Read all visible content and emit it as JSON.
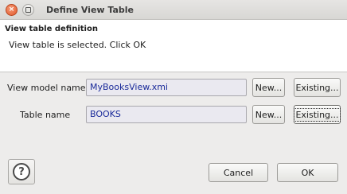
{
  "window": {
    "title": "Define View Table",
    "close_glyph": "×"
  },
  "header": {
    "title": "View table definition",
    "message": "View table is selected. Click OK"
  },
  "form": {
    "view_model_label": "View model name",
    "view_model_value": "MyBooksView.xmi",
    "table_name_label": "Table name",
    "table_name_value": "BOOKS",
    "new_label": "New...",
    "existing_label": "Existing..."
  },
  "footer": {
    "help_glyph": "?",
    "cancel_label": "Cancel",
    "ok_label": "OK"
  },
  "icons": {
    "close": "close-icon",
    "maximize": "maximize-icon",
    "help": "help-icon"
  }
}
